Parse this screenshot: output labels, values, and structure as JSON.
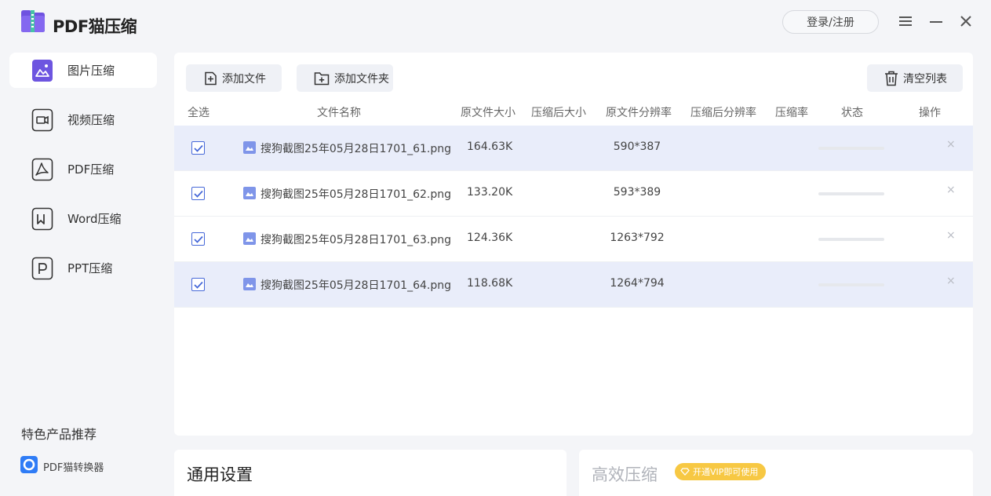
{
  "app": {
    "title": "PDF猫压缩"
  },
  "titlebar": {
    "login_label": "登录/注册"
  },
  "sidebar": {
    "items": [
      {
        "label": "图片压缩",
        "icon": "image-icon",
        "active": true
      },
      {
        "label": "视频压缩",
        "icon": "video-icon",
        "active": false
      },
      {
        "label": "PDF压缩",
        "icon": "pdf-icon",
        "active": false
      },
      {
        "label": "Word压缩",
        "icon": "word-icon",
        "active": false
      },
      {
        "label": "PPT压缩",
        "icon": "ppt-icon",
        "active": false
      }
    ],
    "featured_title": "特色产品推荐",
    "featured_item": "PDF猫转换器"
  },
  "toolbar": {
    "add_file": "添加文件",
    "add_folder": "添加文件夹",
    "clear_list": "清空列表"
  },
  "table": {
    "headers": {
      "select_all": "全选",
      "file_name": "文件名称",
      "orig_size": "原文件大小",
      "comp_size": "压缩后大小",
      "orig_res": "原文件分辨率",
      "comp_res": "压缩后分辨率",
      "ratio": "压缩率",
      "status": "状态",
      "action": "操作"
    },
    "rows": [
      {
        "name": "搜狗截图25年05月28日1701_61.png",
        "size": "164.63K",
        "resolution": "590*387",
        "checked": true,
        "highlight": true,
        "progress": 0
      },
      {
        "name": "搜狗截图25年05月28日1701_62.png",
        "size": "133.20K",
        "resolution": "593*389",
        "checked": true,
        "highlight": false,
        "progress": 0
      },
      {
        "name": "搜狗截图25年05月28日1701_63.png",
        "size": "124.36K",
        "resolution": "1263*792",
        "checked": true,
        "highlight": false,
        "progress": 0
      },
      {
        "name": "搜狗截图25年05月28日1701_64.png",
        "size": "118.68K",
        "resolution": "1264*794",
        "checked": true,
        "highlight": true,
        "progress": 0
      }
    ],
    "delete_symbol": "×"
  },
  "settings": {
    "general_title": "通用设置",
    "efficient_title": "高效压缩",
    "vip_badge": "开通VIP即可使用"
  },
  "colors": {
    "accent": "#4668d8",
    "row_highlight": "#e9edfa",
    "vip": "#f7c843"
  }
}
